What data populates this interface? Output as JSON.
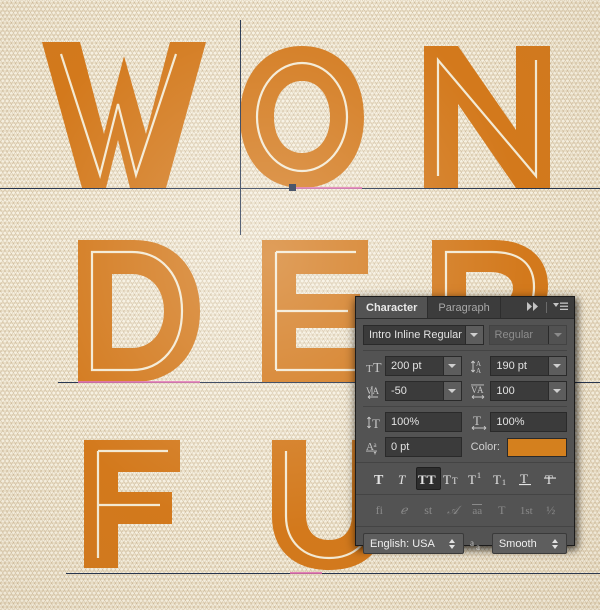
{
  "artwork": {
    "text_lines": [
      "WON",
      "DER",
      "FU"
    ],
    "letters": [
      {
        "char": "W",
        "row": 0
      },
      {
        "char": "O",
        "row": 0
      },
      {
        "char": "N",
        "row": 0
      },
      {
        "char": "D",
        "row": 1
      },
      {
        "char": "E",
        "row": 1
      },
      {
        "char": "R",
        "row": 1
      },
      {
        "char": "F",
        "row": 2
      },
      {
        "char": "U",
        "row": 2
      }
    ],
    "text_color": "#d3791c",
    "inline_color": "#f3ead4",
    "background_color": "#ece2cc",
    "guide_color": "#23334e",
    "selection_color": "#e06fb0"
  },
  "panel": {
    "tabs": [
      {
        "label": "Character",
        "active": true
      },
      {
        "label": "Paragraph",
        "active": false
      }
    ],
    "collapse_icon": "double-chevron-right-icon",
    "menu_icon": "panel-menu-icon",
    "font_family": {
      "icon": "font-family-icon",
      "value": "Intro Inline Regular",
      "dropdown_icon": "chevron-down-icon"
    },
    "font_style": {
      "value": "Regular",
      "disabled": true,
      "dropdown_icon": "chevron-down-icon"
    },
    "font_size": {
      "icon": "font-size-icon",
      "label": "Font Size",
      "value": "200 pt",
      "dropdown_icon": "chevron-down-icon"
    },
    "leading": {
      "icon": "leading-icon",
      "label": "Leading",
      "value": "190 pt",
      "dropdown_icon": "chevron-down-icon"
    },
    "kerning": {
      "icon": "kerning-icon",
      "label": "Kerning",
      "value": "-50",
      "dropdown_icon": "chevron-down-icon"
    },
    "tracking": {
      "icon": "tracking-icon",
      "label": "Tracking",
      "value": "100",
      "dropdown_icon": "chevron-down-icon"
    },
    "vertical_scale": {
      "icon": "vertical-scale-icon",
      "label": "Vertical Scale",
      "value": "100%"
    },
    "horizontal_scale": {
      "icon": "horizontal-scale-icon",
      "label": "Horizontal Scale",
      "value": "100%"
    },
    "baseline_shift": {
      "icon": "baseline-shift-icon",
      "label": "Baseline Shift",
      "value": "0 pt"
    },
    "color": {
      "label": "Color:",
      "swatch_hex": "#d4801e"
    },
    "style_buttons": [
      {
        "name": "faux-bold",
        "glyph": "T",
        "active": false,
        "enabled": true
      },
      {
        "name": "faux-italic",
        "glyph": "T",
        "active": false,
        "enabled": true
      },
      {
        "name": "all-caps",
        "glyph": "TT",
        "active": true,
        "enabled": true
      },
      {
        "name": "small-caps",
        "glyph": "TT",
        "active": false,
        "enabled": true
      },
      {
        "name": "superscript",
        "glyph": "T¹",
        "active": false,
        "enabled": true
      },
      {
        "name": "subscript",
        "glyph": "T₁",
        "active": false,
        "enabled": true
      },
      {
        "name": "underline",
        "glyph": "T",
        "active": false,
        "enabled": true
      },
      {
        "name": "strikethrough",
        "glyph": "T",
        "active": false,
        "enabled": true
      }
    ],
    "opentype_buttons": [
      {
        "name": "standard-ligatures",
        "glyph": "fi",
        "enabled": false
      },
      {
        "name": "contextual-alternates",
        "glyph": "ℯ",
        "enabled": false
      },
      {
        "name": "discretionary-ligatures",
        "glyph": "st",
        "enabled": false
      },
      {
        "name": "swash",
        "glyph": "𝒜",
        "enabled": false
      },
      {
        "name": "stylistic-alternates",
        "glyph": "aa",
        "enabled": false
      },
      {
        "name": "titling-alternates",
        "glyph": "T",
        "enabled": false
      },
      {
        "name": "ordinals",
        "glyph": "1st",
        "enabled": false
      },
      {
        "name": "fractions",
        "glyph": "½",
        "enabled": false
      }
    ],
    "language": {
      "value": "English: USA",
      "spin_icon": "spinner-updown-icon"
    },
    "antialias": {
      "icon": "anti-alias-icon",
      "value": "Smooth",
      "spin_icon": "spinner-updown-icon"
    }
  }
}
